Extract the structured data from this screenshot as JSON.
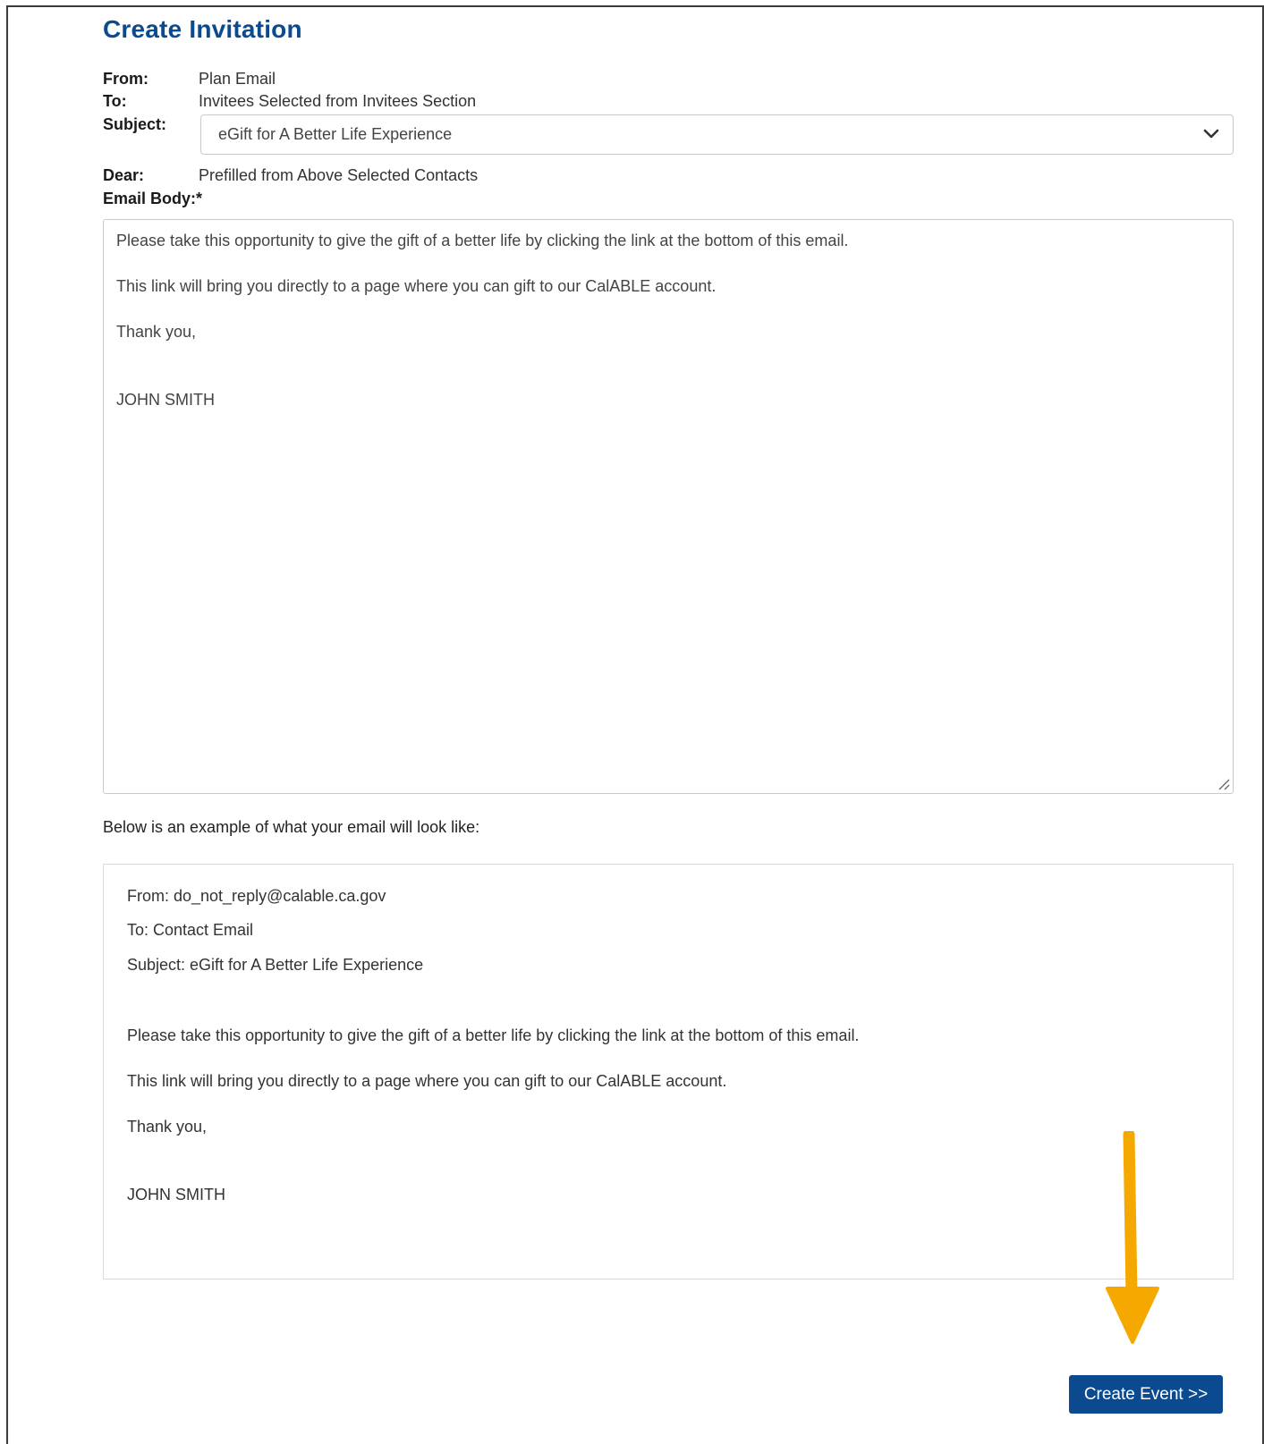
{
  "header": {
    "title": "Create Invitation"
  },
  "fields": {
    "from_label": "From:",
    "from_value": "Plan Email",
    "to_label": "To:",
    "to_value": "Invitees Selected from Invitees Section",
    "subject_label": "Subject:",
    "subject_selected": "eGift for A Better Life Experience",
    "dear_label": "Dear:",
    "dear_value": "Prefilled from Above Selected Contacts",
    "body_label": "Email Body:*"
  },
  "email_body": {
    "line1": "Please take this opportunity to give the gift of a better life by clicking the link at the bottom of this email.",
    "line2": "This link will bring you directly to a page where you can gift to our CalABLE account.",
    "line3": "Thank you,",
    "signature": "JOHN SMITH"
  },
  "preview": {
    "intro": "Below is an example of what your email will look like:",
    "from": "From: do_not_reply@calable.ca.gov",
    "to": "To: Contact Email",
    "subject": "Subject: eGift for A Better Life Experience",
    "line1": "Please take this opportunity to give the gift of a better life by clicking the link at the bottom of this email.",
    "line2": "This link will bring you directly to a page where you can gift to our CalABLE account.",
    "line3": "Thank you,",
    "signature": "JOHN SMITH"
  },
  "actions": {
    "create_event_label": "Create Event >>"
  },
  "icons": {
    "dropdown": "chevron-down-icon",
    "resize": "resize-handle-icon",
    "annotation": "arrow-down-icon"
  },
  "colors": {
    "brand": "#0b4a8f",
    "annotation_arrow": "#f5a800",
    "border": "#c9c9c9"
  }
}
